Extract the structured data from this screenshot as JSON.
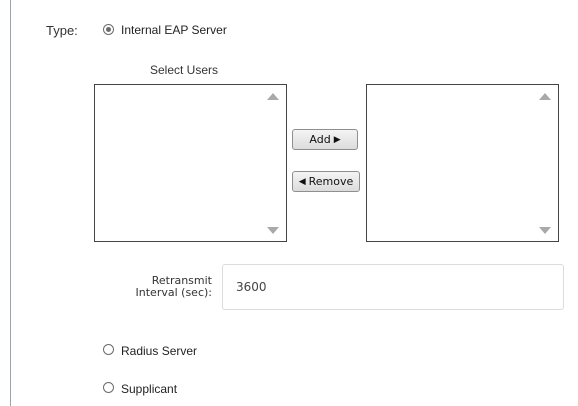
{
  "type_label": "Type:",
  "options": {
    "internal_eap": "Internal EAP Server",
    "radius": "Radius Server",
    "supplicant": "Supplicant",
    "selected": "internal_eap"
  },
  "select_users_label": "Select Users",
  "buttons": {
    "add_label": "Add",
    "add_icon": "▶",
    "remove_label": "Remove",
    "remove_icon": "◀"
  },
  "retransmit": {
    "label_line1": "Retransmit",
    "label_line2": "Interval (sec):",
    "value": "3600"
  }
}
